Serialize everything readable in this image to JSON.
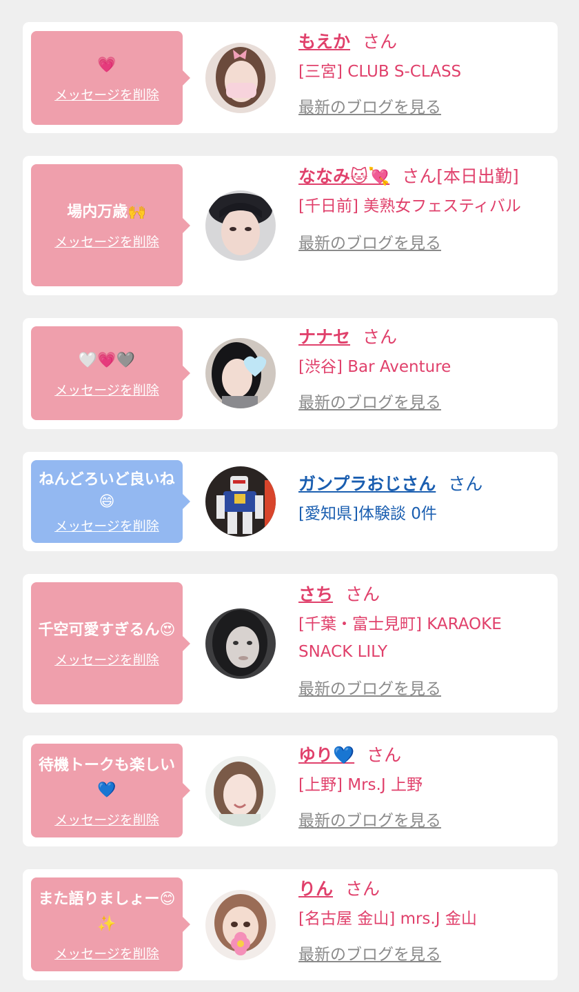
{
  "delete_label": "メッセージを削除",
  "blog_label": "最新のブログを見る",
  "san_label": "さん",
  "colors": {
    "background": "#efefef",
    "card": "#ffffff",
    "bubble_pink": "#ef9fac",
    "bubble_blue": "#93b8f1",
    "cast_name": "#e0406b",
    "user_name": "#1a5eb0",
    "blog_link": "#8a8a8a"
  },
  "cards": [
    {
      "message": "💗",
      "name": "もえか",
      "name_suffix": "",
      "shop": "[三宮] CLUB S-CLASS",
      "avatar": "photo-girl-mask"
    },
    {
      "message": "場内万歳🙌",
      "name": "ななみ🐱💘",
      "name_suffix": "[本日出勤]",
      "shop": "[千日前] 美熟女フェスティバル",
      "avatar": "photo-woman-hat"
    },
    {
      "message": "🤍💗🩶",
      "name": "ナナセ",
      "name_suffix": "",
      "shop": "[渋谷] Bar Aventure",
      "avatar": "photo-girl-heart-sticker"
    },
    {
      "message": "ねんどろいど良いね😄",
      "name": "ガンプラおじさん",
      "name_suffix": "",
      "shop": "[愛知県]体験談 0件",
      "avatar": "photo-gundam-model"
    },
    {
      "message": "千空可愛すぎるん😍",
      "name": "さち",
      "name_suffix": "",
      "shop": "[千葉・富士見町] KARAOKE SNACK LILY",
      "avatar": "photo-woman-mono"
    },
    {
      "message": "待機トークも楽しい💙",
      "name": "ゆり💙",
      "name_suffix": "",
      "shop": "[上野] Mrs.J 上野",
      "avatar": "photo-woman-smile"
    },
    {
      "message": "また語りましょー😊✨",
      "name": "りん",
      "name_suffix": "",
      "shop": "[名古屋 金山] mrs.J 金山",
      "avatar": "photo-girl-flower-sticker"
    }
  ]
}
